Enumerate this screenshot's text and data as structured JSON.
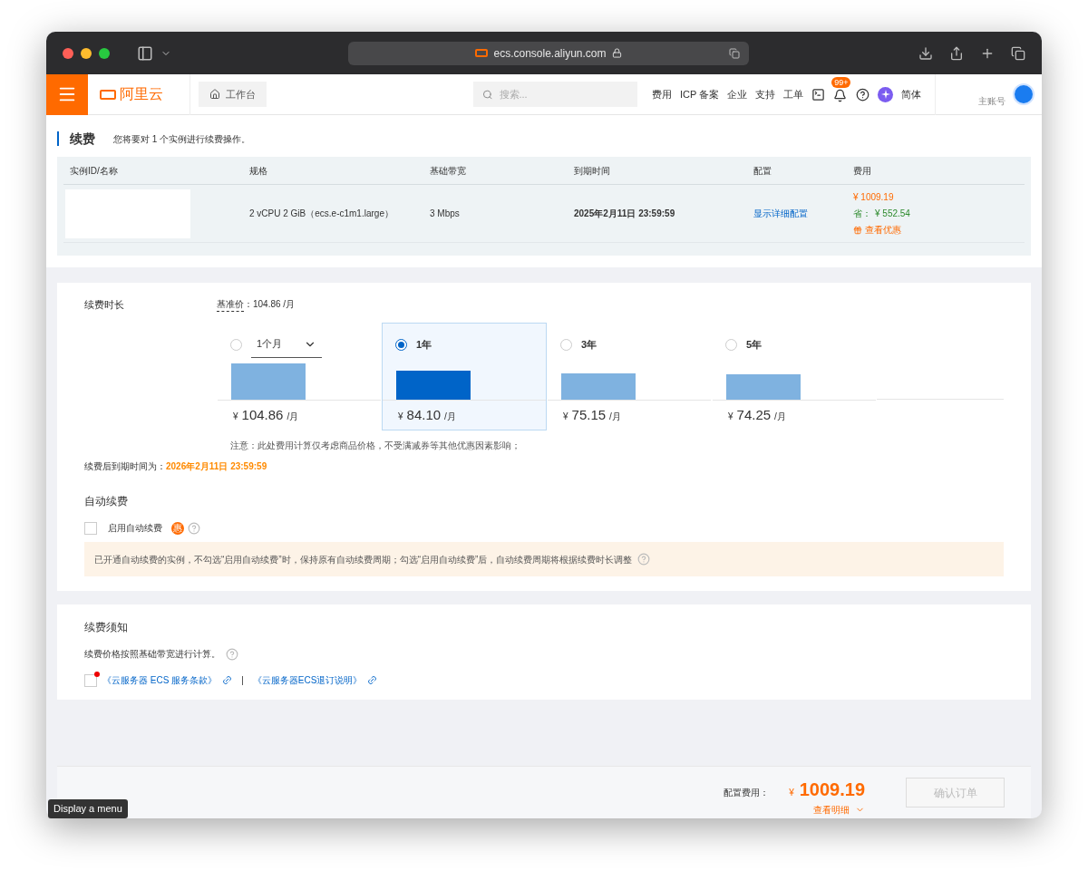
{
  "browser": {
    "url": "ecs.console.aliyun.com",
    "tooltip": "Display a menu"
  },
  "nav": {
    "brand": "阿里云",
    "workbench": "工作台",
    "search_placeholder": "搜索...",
    "links": [
      "费用",
      "ICP 备案",
      "企业",
      "支持",
      "工单"
    ],
    "notification_badge": "99+",
    "language": "简体",
    "account": "主账号"
  },
  "header": {
    "title": "续费",
    "subtitle": "您将要对 1 个实例进行续费操作。"
  },
  "table": {
    "columns": [
      "实例ID/名称",
      "规格",
      "基础带宽",
      "到期时间",
      "配置",
      "费用"
    ],
    "rows": [
      {
        "spec": "2 vCPU 2 GiB（ecs.e-c1m1.large）",
        "bandwidth": "3 Mbps",
        "expiry": "2025年2月11日 23:59:59",
        "config_link": "显示详细配置",
        "price": "¥ 1009.19",
        "saving_label": "省：",
        "saving": "¥ 552.54",
        "offers": "查看优惠"
      }
    ]
  },
  "duration": {
    "label": "续费时长",
    "base_price_label": "基准价",
    "base_price": "：104.86 /月",
    "options": [
      {
        "kind": "dropdown",
        "label": "1个月",
        "selected": false,
        "currency": "¥",
        "price": "104.86",
        "unit": "/月"
      },
      {
        "kind": "radio",
        "label": "1年",
        "selected": true,
        "currency": "¥",
        "price": "84.10",
        "unit": "/月"
      },
      {
        "kind": "radio",
        "label": "3年",
        "selected": false,
        "currency": "¥",
        "price": "75.15",
        "unit": "/月"
      },
      {
        "kind": "radio",
        "label": "5年",
        "selected": false,
        "currency": "¥",
        "price": "74.25",
        "unit": "/月"
      }
    ],
    "note": "注意：此处费用计算仅考虑商品价格，不受满减券等其他优惠因素影响；",
    "new_expiry_label": "续费后到期时间为：",
    "new_expiry": "2026年2月11日 23:59:59"
  },
  "auto_renew": {
    "title": "自动续费",
    "checkbox": {
      "label": "启用自动续费",
      "checked": false,
      "badge": "惠"
    },
    "notice": "已开通自动续费的实例，不勾选“启用自动续费”时，保持原有自动续费周期；勾选“启用自动续费”后，自动续费周期将根据续费时长调整"
  },
  "terms": {
    "title": "续费须知",
    "text": "续费价格按照基础带宽进行计算。",
    "checked": false,
    "links": [
      "《云服务器 ECS 服务条款》",
      "《云服务器ECS退订说明》"
    ],
    "separator": "|"
  },
  "footer": {
    "cost_label": "配置费用：",
    "currency": "¥",
    "amount": "1009.19",
    "detail": "查看明细",
    "confirm": {
      "label": "确认订单",
      "disabled": true
    }
  }
}
